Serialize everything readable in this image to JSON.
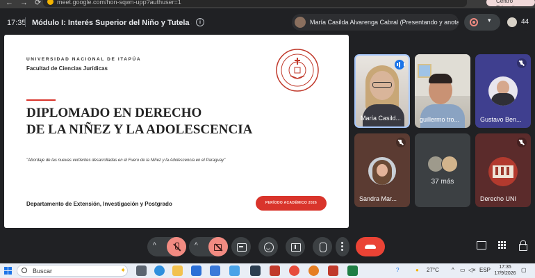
{
  "browser": {
    "url": "meet.google.com/hon-sqwn-upp?authuser=1",
    "profile_chip": "Centro Educativo"
  },
  "header": {
    "time": "17:35",
    "meeting_title": "Módulo I: Interés Superior del Niño y Tutela Judicial ...",
    "presenting": "María Casilda Alvarenga Cabral (Presentando y anotando)",
    "participant_count": "44"
  },
  "slide": {
    "university": "UNIVERSIDAD NACIONAL DE ITAPÚA",
    "faculty": "Facultad de Ciencias Jurídicas",
    "title_line1": "DIPLOMADO EN DERECHO",
    "title_line2": "DE LA NIÑEZ Y LA ADOLESCENCIA",
    "quote": "\"Abordaje de las nuevas vertientes desarrolladas en el Fuero de la Niñez y la Adolescencia en el Paraguay\"",
    "department": "Departamento de Extensión, Investigación y Postgrado",
    "period_button": "PERÍODO ACADÉMICO 2026"
  },
  "participants": [
    {
      "name": "María Casild...",
      "status": "speaking"
    },
    {
      "name": "guillermo tro...",
      "status": "none"
    },
    {
      "name": "Gustavo Ben...",
      "status": "muted"
    },
    {
      "name": "Sandra Mar...",
      "status": "muted"
    },
    {
      "name": "",
      "more_label": "37 más"
    },
    {
      "name": "Derecho UNI",
      "status": "muted"
    }
  ],
  "controls": {
    "caret": "^"
  },
  "taskbar": {
    "search_placeholder": "Buscar",
    "weather": "27°C",
    "language": "ESP",
    "time": "17:35",
    "date": "17/9/2026"
  },
  "colors": {
    "accent_red": "#d9342b",
    "meet_bg": "#202124",
    "control_gray": "#3c4043",
    "mute_red": "#f28b82",
    "hangup_red": "#ea4335"
  }
}
